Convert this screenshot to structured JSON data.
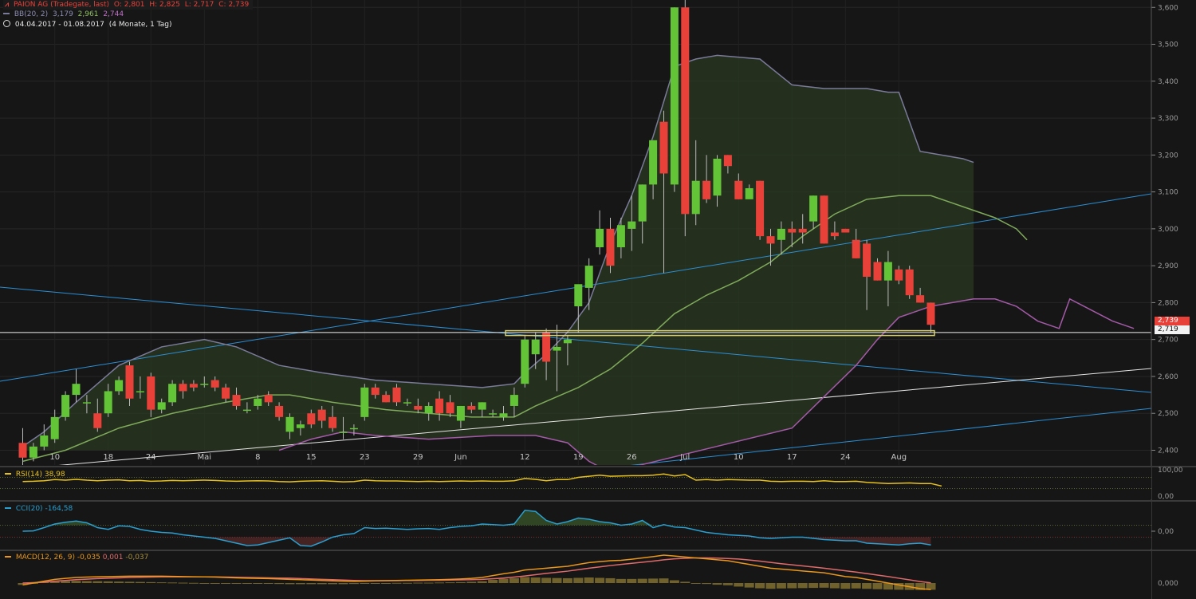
{
  "header": {
    "instrument": "PAION AG (Tradegate, last)",
    "open": "O: 2,801",
    "high": "H: 2,825",
    "low": "L: 2,717",
    "close": "C: 2,739",
    "bb_label": "BB(20, 2)",
    "bb_upper": "3,179",
    "bb_mid": "2,961",
    "bb_lower": "2,744",
    "date_range": "04.04.2017 - 01.08.2017",
    "period": "(4 Monate, 1 Tag)"
  },
  "price_tags": {
    "last": "2,739",
    "support": "2,719"
  },
  "colors": {
    "up": "#63c437",
    "down": "#e8413a",
    "bb_band": "#7a7b9a",
    "bb_mid": "#7faa5a",
    "bb_lower": "#a45aa8",
    "trend_blue": "#2a8fd6",
    "trend_white": "#e6e6e6",
    "rsi": "#e8c21c",
    "cci": "#2a9fd0",
    "macd": "#e8961c",
    "signal": "#e06a6a",
    "hist": "#7a6a2c"
  },
  "chart_data": [
    {
      "type": "candlestick",
      "title": "PAION AG (Tradegate, last)",
      "ylim": [
        2.36,
        3.62
      ],
      "y_ticks": [
        "2,400",
        "2,500",
        "2,600",
        "2,700",
        "2,800",
        "2,900",
        "3,000",
        "3,100",
        "3,200",
        "3,300",
        "3,400",
        "3,500",
        "3,600"
      ],
      "x_ticks": [
        "10",
        "18",
        "24",
        "Mai",
        "8",
        "15",
        "23",
        "29",
        "Jun",
        "12",
        "19",
        "26",
        "Jul",
        "10",
        "17",
        "24",
        "Aug"
      ],
      "x_tick_index": [
        3,
        8,
        12,
        17,
        22,
        27,
        32,
        37,
        41,
        47,
        52,
        57,
        62,
        67,
        72,
        77,
        82
      ],
      "ohlc": [
        [
          2.42,
          2.46,
          2.36,
          2.38
        ],
        [
          2.38,
          2.42,
          2.37,
          2.41
        ],
        [
          2.41,
          2.47,
          2.4,
          2.44
        ],
        [
          2.43,
          2.51,
          2.42,
          2.49
        ],
        [
          2.49,
          2.56,
          2.48,
          2.55
        ],
        [
          2.55,
          2.62,
          2.53,
          2.58
        ],
        [
          2.53,
          2.55,
          2.5,
          2.53
        ],
        [
          2.5,
          2.54,
          2.45,
          2.46
        ],
        [
          2.5,
          2.58,
          2.49,
          2.56
        ],
        [
          2.56,
          2.6,
          2.55,
          2.59
        ],
        [
          2.63,
          2.64,
          2.52,
          2.54
        ],
        [
          2.56,
          2.6,
          2.54,
          2.56
        ],
        [
          2.6,
          2.61,
          2.49,
          2.51
        ],
        [
          2.51,
          2.54,
          2.5,
          2.53
        ],
        [
          2.53,
          2.59,
          2.52,
          2.58
        ],
        [
          2.58,
          2.59,
          2.54,
          2.56
        ],
        [
          2.58,
          2.59,
          2.56,
          2.57
        ],
        [
          2.58,
          2.6,
          2.57,
          2.58
        ],
        [
          2.59,
          2.6,
          2.56,
          2.57
        ],
        [
          2.57,
          2.58,
          2.53,
          2.54
        ],
        [
          2.55,
          2.57,
          2.51,
          2.52
        ],
        [
          2.51,
          2.53,
          2.5,
          2.51
        ],
        [
          2.52,
          2.55,
          2.51,
          2.54
        ],
        [
          2.55,
          2.56,
          2.52,
          2.53
        ],
        [
          2.52,
          2.53,
          2.48,
          2.49
        ],
        [
          2.45,
          2.5,
          2.43,
          2.49
        ],
        [
          2.46,
          2.48,
          2.44,
          2.47
        ],
        [
          2.5,
          2.51,
          2.46,
          2.47
        ],
        [
          2.51,
          2.52,
          2.46,
          2.48
        ],
        [
          2.49,
          2.52,
          2.45,
          2.46
        ],
        [
          2.45,
          2.49,
          2.43,
          2.45
        ],
        [
          2.46,
          2.47,
          2.44,
          2.46
        ],
        [
          2.49,
          2.58,
          2.48,
          2.57
        ],
        [
          2.57,
          2.58,
          2.54,
          2.55
        ],
        [
          2.55,
          2.56,
          2.53,
          2.53
        ],
        [
          2.57,
          2.58,
          2.52,
          2.53
        ],
        [
          2.53,
          2.54,
          2.52,
          2.53
        ],
        [
          2.52,
          2.54,
          2.5,
          2.51
        ],
        [
          2.5,
          2.53,
          2.48,
          2.52
        ],
        [
          2.54,
          2.56,
          2.48,
          2.5
        ],
        [
          2.53,
          2.55,
          2.49,
          2.5
        ],
        [
          2.48,
          2.52,
          2.46,
          2.52
        ],
        [
          2.52,
          2.53,
          2.5,
          2.51
        ],
        [
          2.51,
          2.53,
          2.49,
          2.53
        ],
        [
          2.5,
          2.51,
          2.49,
          2.5
        ],
        [
          2.49,
          2.52,
          2.48,
          2.5
        ],
        [
          2.52,
          2.57,
          2.49,
          2.55
        ],
        [
          2.58,
          2.71,
          2.57,
          2.7
        ],
        [
          2.66,
          2.72,
          2.62,
          2.7
        ],
        [
          2.72,
          2.73,
          2.59,
          2.64
        ],
        [
          2.67,
          2.74,
          2.56,
          2.68
        ],
        [
          2.69,
          2.71,
          2.63,
          2.7
        ],
        [
          2.79,
          2.84,
          2.72,
          2.85
        ],
        [
          2.84,
          2.92,
          2.78,
          2.9
        ],
        [
          2.95,
          3.05,
          2.93,
          3.0
        ],
        [
          3.0,
          3.03,
          2.88,
          2.9
        ],
        [
          2.95,
          3.03,
          2.92,
          3.01
        ],
        [
          3.0,
          3.09,
          2.94,
          3.02
        ],
        [
          3.02,
          3.12,
          2.96,
          3.12
        ],
        [
          3.12,
          3.24,
          3.08,
          3.24
        ],
        [
          3.29,
          3.32,
          2.88,
          3.15
        ],
        [
          3.12,
          3.6,
          3.1,
          3.6
        ],
        [
          3.6,
          3.62,
          2.98,
          3.04
        ],
        [
          3.04,
          3.24,
          3.01,
          3.13
        ],
        [
          3.13,
          3.2,
          3.07,
          3.08
        ],
        [
          3.09,
          3.2,
          3.06,
          3.19
        ],
        [
          3.2,
          3.2,
          3.15,
          3.17
        ],
        [
          3.13,
          3.15,
          3.08,
          3.08
        ],
        [
          3.08,
          3.12,
          3.09,
          3.11
        ],
        [
          3.13,
          3.13,
          2.97,
          2.98
        ],
        [
          2.98,
          3.0,
          2.9,
          2.96
        ],
        [
          2.97,
          3.02,
          2.93,
          3.0
        ],
        [
          3.0,
          3.02,
          2.95,
          2.99
        ],
        [
          3.0,
          3.04,
          2.96,
          2.99
        ],
        [
          3.02,
          3.09,
          3.0,
          3.09
        ],
        [
          3.09,
          3.09,
          2.96,
          2.96
        ],
        [
          2.99,
          3.02,
          2.97,
          2.98
        ],
        [
          3.0,
          3.0,
          2.99,
          2.99
        ],
        [
          2.97,
          3.0,
          2.92,
          2.92
        ],
        [
          2.96,
          2.97,
          2.78,
          2.87
        ],
        [
          2.91,
          2.92,
          2.86,
          2.86
        ],
        [
          2.86,
          2.94,
          2.79,
          2.91
        ],
        [
          2.89,
          2.9,
          2.85,
          2.86
        ],
        [
          2.89,
          2.9,
          2.81,
          2.82
        ],
        [
          2.82,
          2.84,
          2.8,
          2.8
        ],
        [
          2.8,
          2.8,
          2.72,
          2.74
        ]
      ],
      "bb_upper": [
        [
          0,
          2.41
        ],
        [
          2,
          2.45
        ],
        [
          5,
          2.53
        ],
        [
          9,
          2.63
        ],
        [
          13,
          2.68
        ],
        [
          17,
          2.7
        ],
        [
          20,
          2.68
        ],
        [
          24,
          2.63
        ],
        [
          28,
          2.61
        ],
        [
          33,
          2.59
        ],
        [
          38,
          2.58
        ],
        [
          43,
          2.57
        ],
        [
          46,
          2.58
        ],
        [
          47,
          2.61
        ],
        [
          49,
          2.66
        ],
        [
          51,
          2.72
        ],
        [
          53,
          2.8
        ],
        [
          55,
          2.96
        ],
        [
          57,
          3.09
        ],
        [
          59,
          3.25
        ],
        [
          61,
          3.44
        ],
        [
          63,
          3.46
        ],
        [
          65,
          3.47
        ],
        [
          69,
          3.46
        ],
        [
          72,
          3.39
        ],
        [
          75,
          3.38
        ],
        [
          79,
          3.38
        ],
        [
          81,
          3.37
        ],
        [
          82,
          3.37
        ],
        [
          84,
          3.21
        ],
        [
          86,
          3.2
        ],
        [
          88,
          3.19
        ],
        [
          89,
          3.18
        ]
      ],
      "bb_mid": [
        [
          0,
          2.37
        ],
        [
          4,
          2.4
        ],
        [
          9,
          2.46
        ],
        [
          14,
          2.5
        ],
        [
          19,
          2.53
        ],
        [
          23,
          2.55
        ],
        [
          25,
          2.55
        ],
        [
          29,
          2.53
        ],
        [
          34,
          2.51
        ],
        [
          38,
          2.5
        ],
        [
          42,
          2.49
        ],
        [
          46,
          2.49
        ],
        [
          48,
          2.52
        ],
        [
          52,
          2.57
        ],
        [
          55,
          2.62
        ],
        [
          58,
          2.69
        ],
        [
          61,
          2.77
        ],
        [
          64,
          2.82
        ],
        [
          67,
          2.86
        ],
        [
          70,
          2.91
        ],
        [
          73,
          2.98
        ],
        [
          76,
          3.04
        ],
        [
          79,
          3.08
        ],
        [
          82,
          3.09
        ],
        [
          85,
          3.09
        ],
        [
          88,
          3.06
        ],
        [
          91,
          3.03
        ],
        [
          93,
          3.0
        ],
        [
          94,
          2.97
        ]
      ],
      "bb_lower": [
        [
          24,
          2.4
        ],
        [
          27,
          2.43
        ],
        [
          30,
          2.45
        ],
        [
          33,
          2.44
        ],
        [
          38,
          2.43
        ],
        [
          44,
          2.44
        ],
        [
          48,
          2.44
        ],
        [
          51,
          2.42
        ],
        [
          53,
          2.37
        ],
        [
          55,
          2.34
        ],
        [
          72,
          2.46
        ],
        [
          78,
          2.63
        ],
        [
          80,
          2.7
        ],
        [
          82,
          2.76
        ],
        [
          85,
          2.79
        ],
        [
          89,
          2.81
        ],
        [
          91,
          2.81
        ],
        [
          93,
          2.79
        ],
        [
          95,
          2.75
        ],
        [
          97,
          2.73
        ],
        [
          98,
          2.81
        ],
        [
          100,
          2.78
        ],
        [
          102,
          2.75
        ],
        [
          104,
          2.73
        ]
      ],
      "support_line": 2.719,
      "support_zone": [
        2.711,
        2.724
      ]
    },
    {
      "type": "line",
      "title": "RSI(14)",
      "value_label": "38,98",
      "ylim": [
        0,
        100
      ],
      "y_ticks": [
        "100,00",
        "0,00"
      ],
      "values": [
        55,
        56,
        58,
        62,
        60,
        63,
        60,
        58,
        60,
        61,
        58,
        59,
        56,
        57,
        59,
        58,
        59,
        60,
        59,
        57,
        56,
        57,
        58,
        57,
        55,
        54,
        56,
        57,
        58,
        56,
        54,
        55,
        60,
        58,
        57,
        57,
        56,
        55,
        56,
        55,
        56,
        57,
        56,
        57,
        56,
        56,
        58,
        66,
        63,
        58,
        62,
        62,
        70,
        74,
        78,
        74,
        75,
        76,
        76,
        78,
        82,
        75,
        80,
        60,
        62,
        60,
        62,
        61,
        60,
        60,
        56,
        55,
        56,
        56,
        55,
        58,
        55,
        55,
        56,
        52,
        50,
        48,
        49,
        50,
        48,
        48,
        39
      ]
    },
    {
      "type": "line",
      "title": "CCI(20)",
      "value_label": "-164,58",
      "ylim": [
        -400,
        400
      ],
      "y_ticks": [
        "0,00"
      ],
      "values": [
        0,
        5,
        60,
        120,
        150,
        170,
        140,
        60,
        30,
        90,
        80,
        30,
        0,
        -20,
        -30,
        -60,
        -80,
        -100,
        -120,
        -160,
        -200,
        -240,
        -230,
        -190,
        -150,
        -110,
        -240,
        -250,
        -180,
        -100,
        -60,
        -40,
        60,
        45,
        50,
        40,
        30,
        40,
        45,
        30,
        60,
        80,
        90,
        120,
        110,
        100,
        120,
        350,
        330,
        180,
        120,
        160,
        220,
        200,
        160,
        140,
        100,
        120,
        180,
        60,
        110,
        70,
        60,
        20,
        -20,
        -40,
        -60,
        -70,
        -80,
        -110,
        -120,
        -110,
        -100,
        -100,
        -120,
        -140,
        -150,
        -160,
        -160,
        -200,
        -210,
        -220,
        -230,
        -210,
        -200,
        -230
      ]
    },
    {
      "type": "bar",
      "title": "MACD(12, 26, 9)",
      "value_labels": [
        "-0,035",
        "0,001",
        "-0,037"
      ],
      "ylim": [
        -0.06,
        0.15
      ],
      "y_ticks": [
        "0,000"
      ],
      "macd": [
        -0.01,
        0.0,
        0.01,
        0.02,
        0.025,
        0.03,
        0.032,
        0.034,
        0.035,
        0.036,
        0.037,
        0.037,
        0.037,
        0.037,
        0.036,
        0.035,
        0.034,
        0.033,
        0.032,
        0.03,
        0.028,
        0.026,
        0.025,
        0.024,
        0.022,
        0.02,
        0.018,
        0.016,
        0.014,
        0.012,
        0.01,
        0.009,
        0.01,
        0.012,
        0.013,
        0.014,
        0.015,
        0.016,
        0.017,
        0.018,
        0.02,
        0.022,
        0.025,
        0.03,
        0.04,
        0.05,
        0.058,
        0.07,
        0.075,
        0.08,
        0.085,
        0.09,
        0.1,
        0.11,
        0.115,
        0.12,
        0.122,
        0.128,
        0.135,
        0.142,
        0.15,
        0.145,
        0.14,
        0.135,
        0.13,
        0.125,
        0.12,
        0.11,
        0.1,
        0.09,
        0.08,
        0.075,
        0.07,
        0.065,
        0.06,
        0.055,
        0.045,
        0.035,
        0.03,
        0.02,
        0.01,
        0.0,
        -0.01,
        -0.02,
        -0.03,
        -0.035
      ],
      "signal": [
        0.0,
        0.002,
        0.005,
        0.01,
        0.014,
        0.018,
        0.021,
        0.024,
        0.026,
        0.028,
        0.03,
        0.031,
        0.032,
        0.033,
        0.033,
        0.033,
        0.033,
        0.033,
        0.033,
        0.032,
        0.031,
        0.03,
        0.029,
        0.028,
        0.027,
        0.026,
        0.024,
        0.022,
        0.02,
        0.018,
        0.016,
        0.014,
        0.013,
        0.013,
        0.013,
        0.013,
        0.014,
        0.014,
        0.015,
        0.015,
        0.016,
        0.017,
        0.018,
        0.02,
        0.023,
        0.027,
        0.032,
        0.038,
        0.045,
        0.052,
        0.058,
        0.064,
        0.072,
        0.08,
        0.087,
        0.094,
        0.1,
        0.106,
        0.112,
        0.118,
        0.125,
        0.13,
        0.133,
        0.135,
        0.135,
        0.134,
        0.132,
        0.129,
        0.124,
        0.118,
        0.111,
        0.104,
        0.098,
        0.092,
        0.086,
        0.08,
        0.073,
        0.066,
        0.059,
        0.051,
        0.043,
        0.035,
        0.026,
        0.017,
        0.008,
        0.001
      ]
    }
  ]
}
